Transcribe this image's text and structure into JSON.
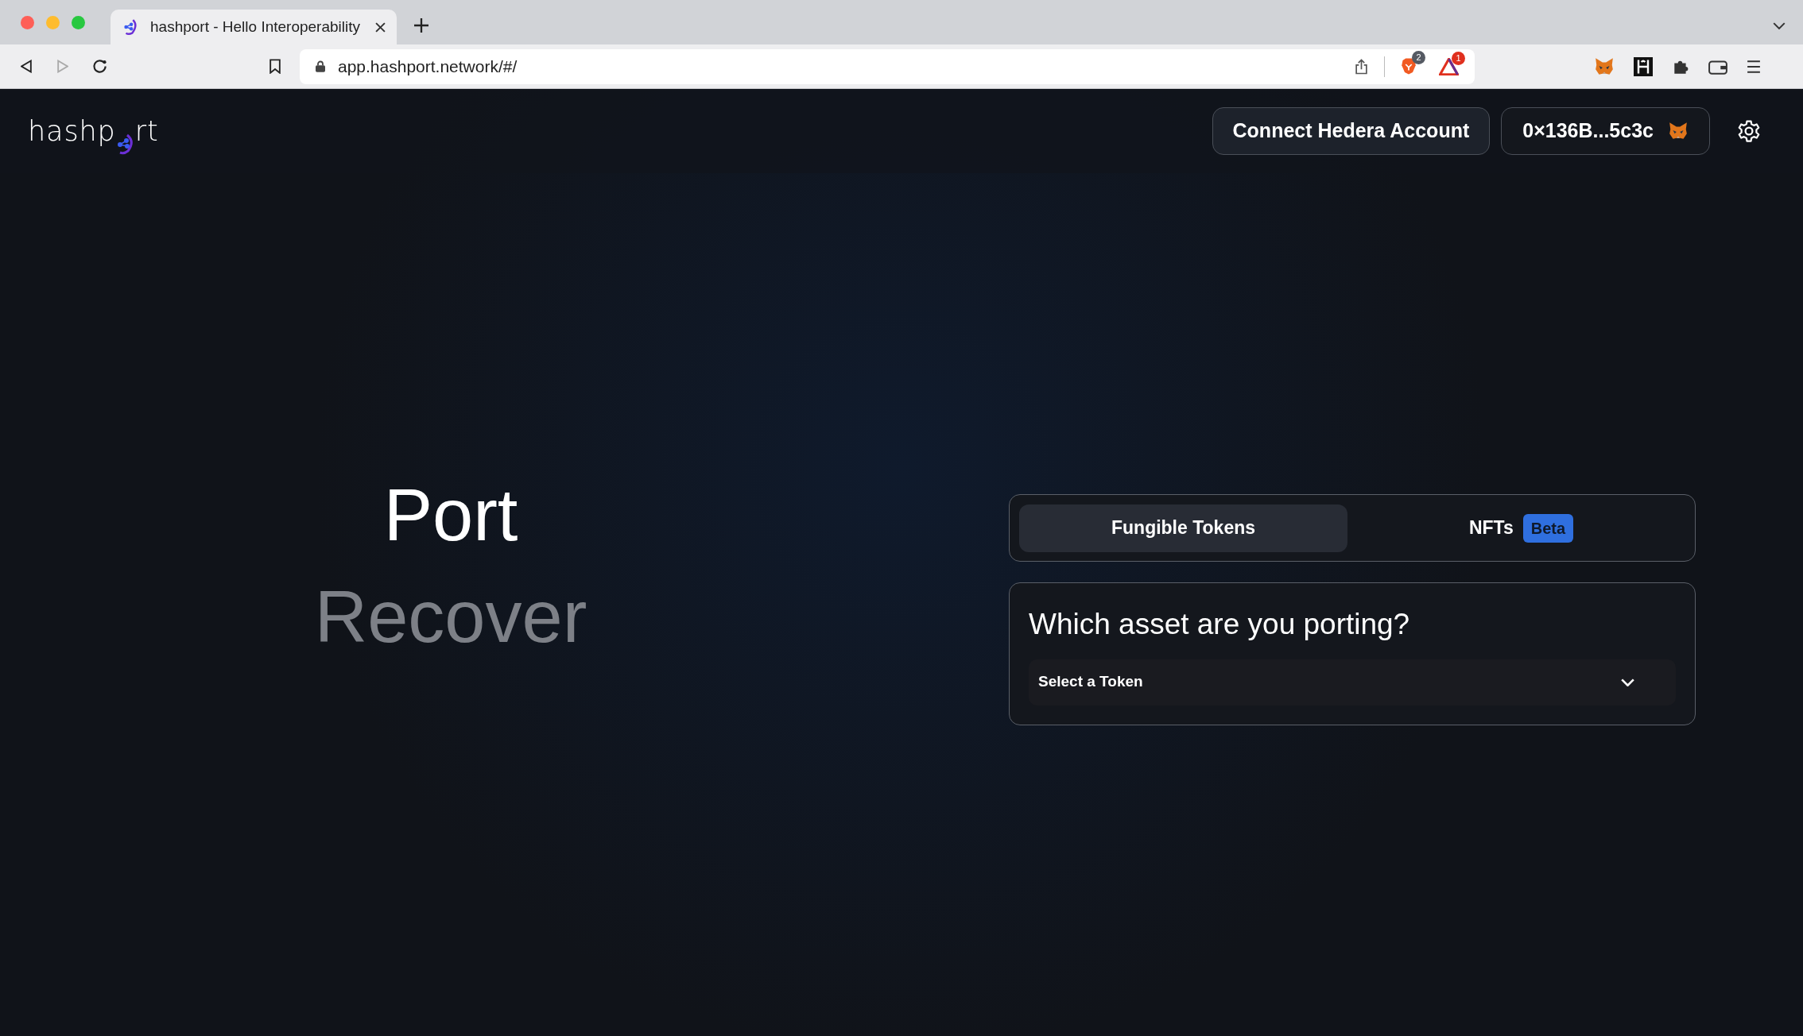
{
  "browser": {
    "tab_title": "hashport - Hello Interoperability",
    "url": "app.hashport.network/#/",
    "shields_count": "2",
    "rewards_count": "1"
  },
  "logo": {
    "before": "hashp",
    "after": "rt"
  },
  "header": {
    "connect_button": "Connect Hedera Account",
    "wallet_button": "0×136B...5c3c"
  },
  "modes": [
    {
      "label": "Port",
      "selected": true
    },
    {
      "label": "Recover",
      "selected": false
    }
  ],
  "asset_tabs": [
    {
      "label": "Fungible Tokens",
      "selected": true
    },
    {
      "label": "NFTs",
      "selected": false,
      "badge": "Beta"
    }
  ],
  "asset_card": {
    "question": "Which asset are you porting?",
    "select_placeholder": "Select a Token"
  }
}
